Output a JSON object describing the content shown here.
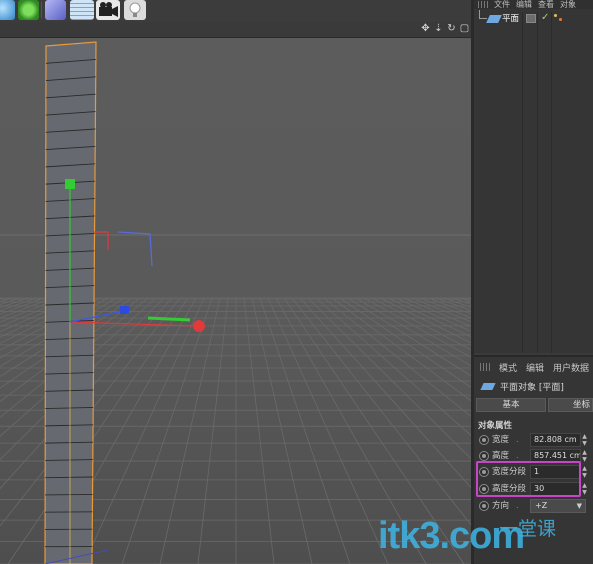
{
  "toolbar": {
    "icons": [
      "cube-icon",
      "gear-green-icon",
      "nurbs-icon",
      "grid-plane-icon",
      "camera-icon",
      "light-bulb-icon"
    ]
  },
  "viewport": {
    "nav_icons": [
      "move-view-icon",
      "zoom-view-icon",
      "rotate-view-icon",
      "maximize-view-icon"
    ]
  },
  "object_manager": {
    "menu": [
      "文件",
      "编辑",
      "查看",
      "对象"
    ],
    "object_name": "平面"
  },
  "attribute_manager": {
    "menu": [
      "模式",
      "编辑",
      "用户数据"
    ],
    "title": "平面对象 [平面]",
    "tabs": {
      "basic": "基本",
      "coord": "坐标"
    },
    "section": "对象属性",
    "properties": [
      {
        "label": "宽度",
        "dots": ".",
        "value": "82.808 cm"
      },
      {
        "label": "高度",
        "dots": ".",
        "value": "857.451 cm"
      },
      {
        "label": "宽度分段",
        "dots": "",
        "value": "1"
      },
      {
        "label": "高度分段",
        "dots": "",
        "value": "30"
      },
      {
        "label": "方向",
        "dots": ".",
        "value": "+Z"
      }
    ]
  },
  "watermark": {
    "logo_text": "itk3.com",
    "tagline": "一堂课"
  },
  "colors": {
    "accent_highlight": "#c844c8",
    "object_selection": "#e89a3c",
    "x_axis": "#e03a3a",
    "y_axis": "#3ac43a",
    "z_axis": "#3a5ae0",
    "watermark": "#3fb6e6"
  }
}
